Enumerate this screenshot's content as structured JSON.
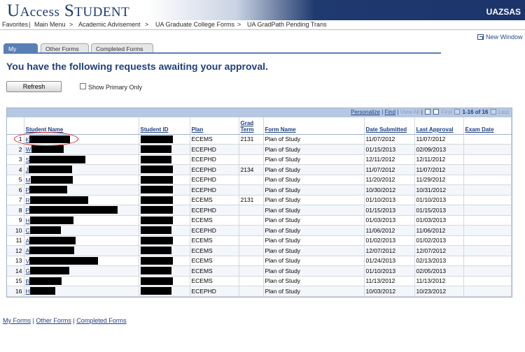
{
  "header": {
    "logo_u": "U",
    "logo_access": "Access",
    "logo_s": "S",
    "logo_tudent": "TUDENT",
    "right_text": "UAZSAS"
  },
  "nav": {
    "favorites": "Favorites",
    "main_menu": "Main Menu",
    "academic": "Academic Advisement",
    "grad_college": "UA Graduate College Forms",
    "gradpath": "UA GradPath Pending Trans",
    "sep": ">"
  },
  "new_window": "New Window",
  "tabs": [
    "My Forms",
    "Other Forms",
    "Completed Forms"
  ],
  "title": "You have the following requests awaiting your approval.",
  "refresh_label": "Refresh",
  "show_primary_label": "Show Primary Only",
  "grid_links": {
    "personalize": "Personalize",
    "find": "Find",
    "view_all": "View All",
    "first": "First",
    "range": "1-16 of 16",
    "last": "Last"
  },
  "columns": [
    "Student Name",
    "Student ID",
    "Plan",
    "Grad Term",
    "Form Name",
    "Date Submitted",
    "Last Approval",
    "Exam Date"
  ],
  "rows": [
    {
      "n": "1",
      "init": "K",
      "w": 58,
      "idw": 46,
      "plan": "ECEMS",
      "term": "2131",
      "form": "Plan of Study",
      "sub": "11/07/2012",
      "appr": "11/07/2012"
    },
    {
      "n": "2",
      "init": "W",
      "w": 46,
      "idw": 44,
      "plan": "ECEPHD",
      "term": "",
      "form": "Plan of Study",
      "sub": "01/15/2013",
      "appr": "02/09/2013"
    },
    {
      "n": "3",
      "init": "S",
      "w": 80,
      "idw": 44,
      "plan": "ECEPHD",
      "term": "",
      "form": "Plan of Study",
      "sub": "12/11/2012",
      "appr": "12/11/2012"
    },
    {
      "n": "4",
      "init": "J",
      "w": 62,
      "idw": 46,
      "plan": "ECEPHD",
      "term": "2134",
      "form": "Plan of Study",
      "sub": "11/07/2012",
      "appr": "11/07/2012"
    },
    {
      "n": "5",
      "init": "M",
      "w": 60,
      "idw": 46,
      "plan": "ECEPHD",
      "term": "",
      "form": "Plan of Study",
      "sub": "11/20/2012",
      "appr": "11/29/2012"
    },
    {
      "n": "6",
      "init": "P",
      "w": 54,
      "idw": 46,
      "plan": "ECEPHD",
      "term": "",
      "form": "Plan of Study",
      "sub": "10/30/2012",
      "appr": "10/31/2012"
    },
    {
      "n": "7",
      "init": "R",
      "w": 83,
      "idw": 46,
      "plan": "ECEMS",
      "term": "2131",
      "form": "Plan of Study",
      "sub": "01/10/2013",
      "appr": "01/10/2013"
    },
    {
      "n": "8",
      "init": "P",
      "w": 126,
      "idw": 46,
      "plan": "ECEPHD",
      "term": "",
      "form": "Plan of Study",
      "sub": "01/15/2013",
      "appr": "01/15/2013"
    },
    {
      "n": "9",
      "init": "H",
      "w": 62,
      "idw": 46,
      "plan": "ECEMS",
      "term": "",
      "form": "Plan of Study",
      "sub": "01/03/2013",
      "appr": "01/03/2013"
    },
    {
      "n": "10",
      "init": "C",
      "w": 44,
      "idw": 44,
      "plan": "ECEPHD",
      "term": "",
      "form": "Plan of Study",
      "sub": "11/06/2012",
      "appr": "11/06/2012"
    },
    {
      "n": "11",
      "init": "A",
      "w": 66,
      "idw": 46,
      "plan": "ECEMS",
      "term": "",
      "form": "Plan of Study",
      "sub": "01/02/2013",
      "appr": "01/02/2013"
    },
    {
      "n": "12",
      "init": "A",
      "w": 64,
      "idw": 44,
      "plan": "ECEMS",
      "term": "",
      "form": "Plan of Study",
      "sub": "12/07/2012",
      "appr": "12/07/2012"
    },
    {
      "n": "13",
      "init": "V",
      "w": 98,
      "idw": 46,
      "plan": "ECEMS",
      "term": "",
      "form": "Plan of Study",
      "sub": "01/24/2013",
      "appr": "02/13/2013"
    },
    {
      "n": "14",
      "init": "G",
      "w": 56,
      "idw": 44,
      "plan": "ECEMS",
      "term": "",
      "form": "Plan of Study",
      "sub": "01/10/2013",
      "appr": "02/05/2013"
    },
    {
      "n": "15",
      "init": "B",
      "w": 46,
      "idw": 46,
      "plan": "ECEMS",
      "term": "",
      "form": "Plan of Study",
      "sub": "11/13/2012",
      "appr": "11/13/2012"
    },
    {
      "n": "16",
      "init": "H",
      "w": 36,
      "idw": 44,
      "plan": "ECEPHD",
      "term": "",
      "form": "Plan of Study",
      "sub": "10/03/2012",
      "appr": "10/23/2012"
    }
  ],
  "bottom_links": [
    "My Forms",
    "Other Forms",
    "Completed Forms"
  ],
  "bottom_sep": "|",
  "colors": {
    "accent": "#1d3f80",
    "tab_active": "#5a7fb5",
    "annotation": "#d21e1e"
  }
}
